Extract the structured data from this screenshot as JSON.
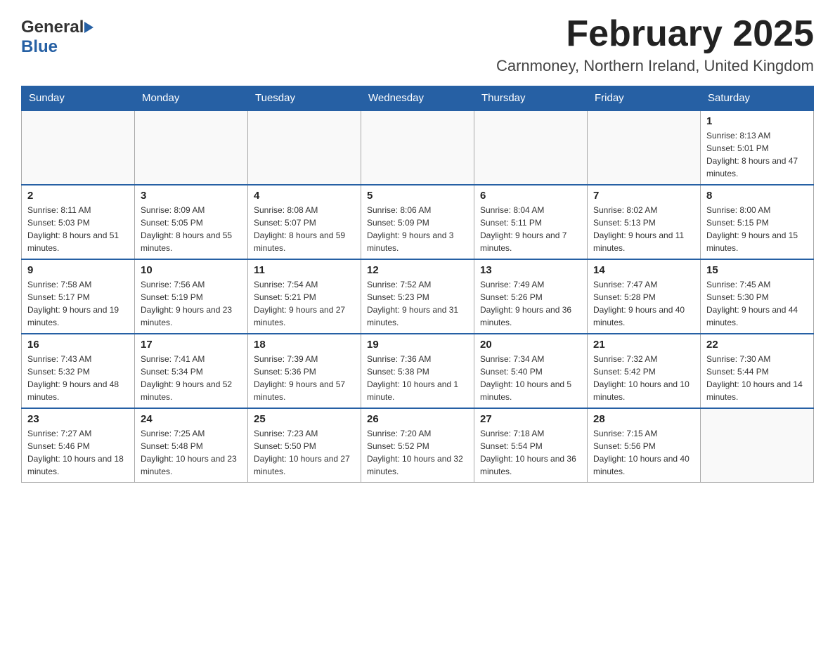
{
  "header": {
    "month_title": "February 2025",
    "location": "Carnmoney, Northern Ireland, United Kingdom",
    "logo_general": "General",
    "logo_blue": "Blue"
  },
  "days_of_week": [
    "Sunday",
    "Monday",
    "Tuesday",
    "Wednesday",
    "Thursday",
    "Friday",
    "Saturday"
  ],
  "weeks": [
    [
      {
        "day": "",
        "info": ""
      },
      {
        "day": "",
        "info": ""
      },
      {
        "day": "",
        "info": ""
      },
      {
        "day": "",
        "info": ""
      },
      {
        "day": "",
        "info": ""
      },
      {
        "day": "",
        "info": ""
      },
      {
        "day": "1",
        "info": "Sunrise: 8:13 AM\nSunset: 5:01 PM\nDaylight: 8 hours and 47 minutes."
      }
    ],
    [
      {
        "day": "2",
        "info": "Sunrise: 8:11 AM\nSunset: 5:03 PM\nDaylight: 8 hours and 51 minutes."
      },
      {
        "day": "3",
        "info": "Sunrise: 8:09 AM\nSunset: 5:05 PM\nDaylight: 8 hours and 55 minutes."
      },
      {
        "day": "4",
        "info": "Sunrise: 8:08 AM\nSunset: 5:07 PM\nDaylight: 8 hours and 59 minutes."
      },
      {
        "day": "5",
        "info": "Sunrise: 8:06 AM\nSunset: 5:09 PM\nDaylight: 9 hours and 3 minutes."
      },
      {
        "day": "6",
        "info": "Sunrise: 8:04 AM\nSunset: 5:11 PM\nDaylight: 9 hours and 7 minutes."
      },
      {
        "day": "7",
        "info": "Sunrise: 8:02 AM\nSunset: 5:13 PM\nDaylight: 9 hours and 11 minutes."
      },
      {
        "day": "8",
        "info": "Sunrise: 8:00 AM\nSunset: 5:15 PM\nDaylight: 9 hours and 15 minutes."
      }
    ],
    [
      {
        "day": "9",
        "info": "Sunrise: 7:58 AM\nSunset: 5:17 PM\nDaylight: 9 hours and 19 minutes."
      },
      {
        "day": "10",
        "info": "Sunrise: 7:56 AM\nSunset: 5:19 PM\nDaylight: 9 hours and 23 minutes."
      },
      {
        "day": "11",
        "info": "Sunrise: 7:54 AM\nSunset: 5:21 PM\nDaylight: 9 hours and 27 minutes."
      },
      {
        "day": "12",
        "info": "Sunrise: 7:52 AM\nSunset: 5:23 PM\nDaylight: 9 hours and 31 minutes."
      },
      {
        "day": "13",
        "info": "Sunrise: 7:49 AM\nSunset: 5:26 PM\nDaylight: 9 hours and 36 minutes."
      },
      {
        "day": "14",
        "info": "Sunrise: 7:47 AM\nSunset: 5:28 PM\nDaylight: 9 hours and 40 minutes."
      },
      {
        "day": "15",
        "info": "Sunrise: 7:45 AM\nSunset: 5:30 PM\nDaylight: 9 hours and 44 minutes."
      }
    ],
    [
      {
        "day": "16",
        "info": "Sunrise: 7:43 AM\nSunset: 5:32 PM\nDaylight: 9 hours and 48 minutes."
      },
      {
        "day": "17",
        "info": "Sunrise: 7:41 AM\nSunset: 5:34 PM\nDaylight: 9 hours and 52 minutes."
      },
      {
        "day": "18",
        "info": "Sunrise: 7:39 AM\nSunset: 5:36 PM\nDaylight: 9 hours and 57 minutes."
      },
      {
        "day": "19",
        "info": "Sunrise: 7:36 AM\nSunset: 5:38 PM\nDaylight: 10 hours and 1 minute."
      },
      {
        "day": "20",
        "info": "Sunrise: 7:34 AM\nSunset: 5:40 PM\nDaylight: 10 hours and 5 minutes."
      },
      {
        "day": "21",
        "info": "Sunrise: 7:32 AM\nSunset: 5:42 PM\nDaylight: 10 hours and 10 minutes."
      },
      {
        "day": "22",
        "info": "Sunrise: 7:30 AM\nSunset: 5:44 PM\nDaylight: 10 hours and 14 minutes."
      }
    ],
    [
      {
        "day": "23",
        "info": "Sunrise: 7:27 AM\nSunset: 5:46 PM\nDaylight: 10 hours and 18 minutes."
      },
      {
        "day": "24",
        "info": "Sunrise: 7:25 AM\nSunset: 5:48 PM\nDaylight: 10 hours and 23 minutes."
      },
      {
        "day": "25",
        "info": "Sunrise: 7:23 AM\nSunset: 5:50 PM\nDaylight: 10 hours and 27 minutes."
      },
      {
        "day": "26",
        "info": "Sunrise: 7:20 AM\nSunset: 5:52 PM\nDaylight: 10 hours and 32 minutes."
      },
      {
        "day": "27",
        "info": "Sunrise: 7:18 AM\nSunset: 5:54 PM\nDaylight: 10 hours and 36 minutes."
      },
      {
        "day": "28",
        "info": "Sunrise: 7:15 AM\nSunset: 5:56 PM\nDaylight: 10 hours and 40 minutes."
      },
      {
        "day": "",
        "info": ""
      }
    ]
  ]
}
